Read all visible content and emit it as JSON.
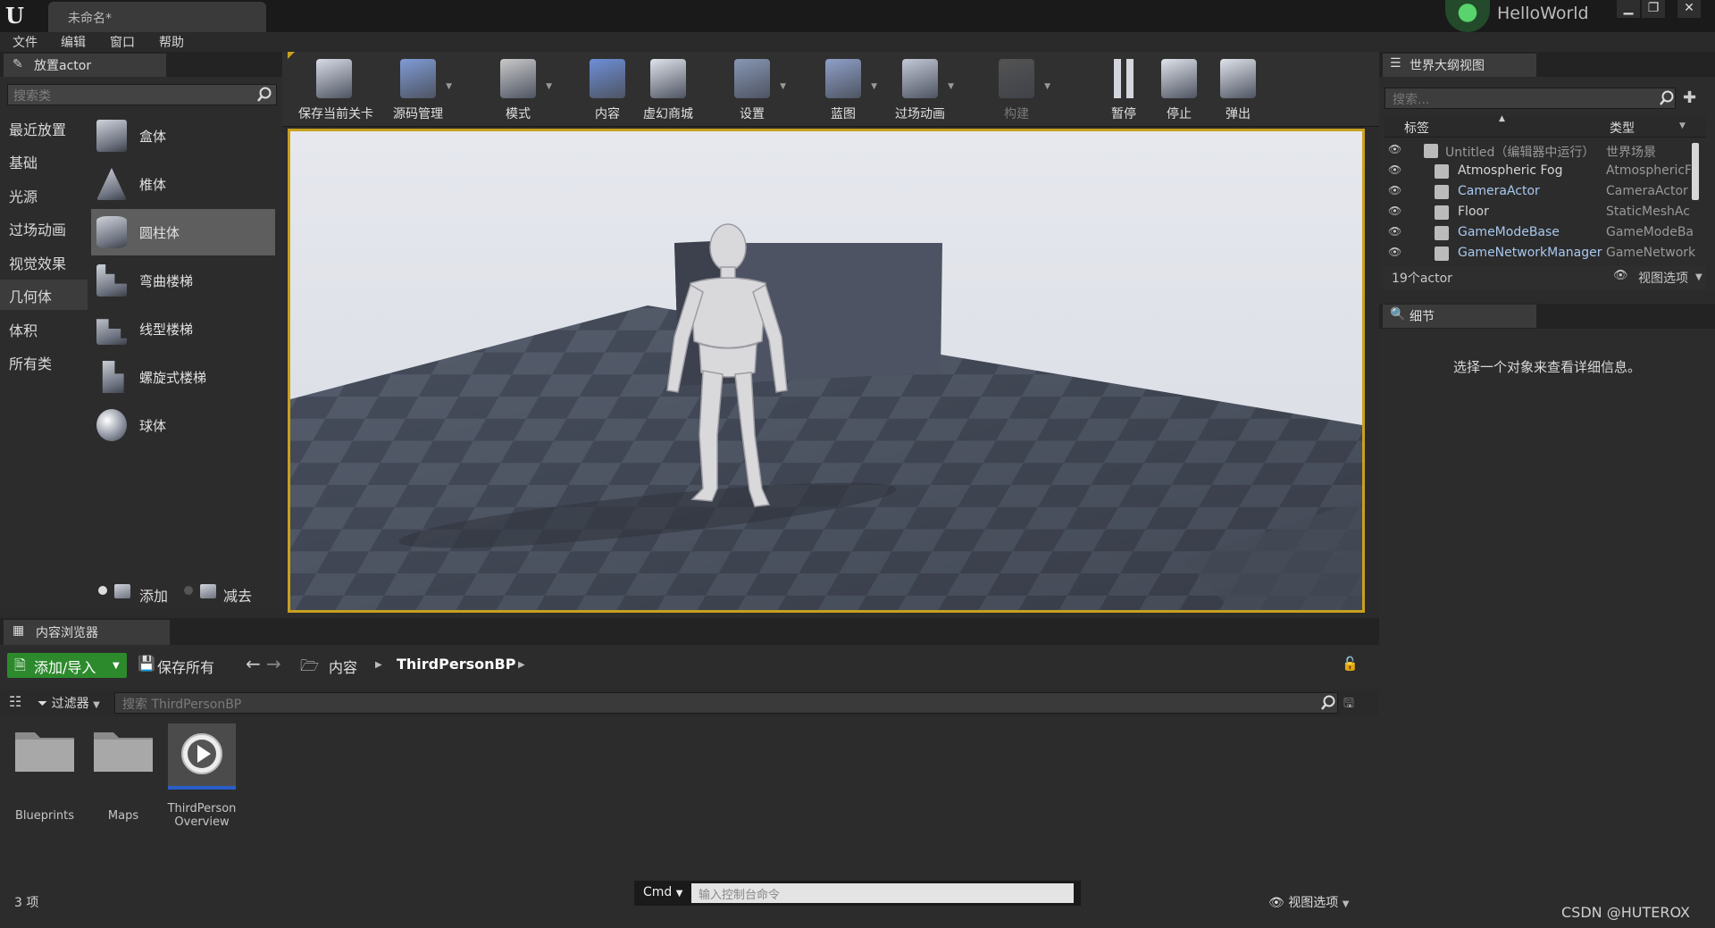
{
  "title_bar": {
    "tab_label": "未命名*",
    "project_name": "HelloWorld",
    "logo_text": "U"
  },
  "menu": [
    "文件",
    "编辑",
    "窗口",
    "帮助"
  ],
  "place_actor": {
    "tab_label": "放置actor",
    "search_placeholder": "搜索类",
    "categories": [
      "最近放置",
      "基础",
      "光源",
      "过场动画",
      "视觉效果",
      "几何体",
      "体积",
      "所有类"
    ],
    "active_category": "几何体",
    "items": [
      "盒体",
      "椎体",
      "圆柱体",
      "弯曲楼梯",
      "线型楼梯",
      "螺旋式楼梯",
      "球体"
    ],
    "selected_item": "圆柱体",
    "mode_add": "添加",
    "mode_subtract": "减去"
  },
  "toolbar": {
    "items": [
      {
        "label": "保存当前关卡",
        "icon": "save-icon",
        "dropdown": false
      },
      {
        "label": "源码管理",
        "icon": "source-control-icon",
        "dropdown": true
      },
      {
        "label": "模式",
        "icon": "modes-icon",
        "dropdown": true
      },
      {
        "label": "内容",
        "icon": "content-icon",
        "dropdown": false
      },
      {
        "label": "虚幻商城",
        "icon": "marketplace-icon",
        "dropdown": false
      },
      {
        "label": "设置",
        "icon": "settings-icon",
        "dropdown": true
      },
      {
        "label": "蓝图",
        "icon": "blueprint-icon",
        "dropdown": true
      },
      {
        "label": "过场动画",
        "icon": "cinematics-icon",
        "dropdown": true
      },
      {
        "label": "构建",
        "icon": "build-icon",
        "dropdown": true
      },
      {
        "label": "暂停",
        "icon": "pause-icon",
        "dropdown": false
      },
      {
        "label": "停止",
        "icon": "stop-icon",
        "dropdown": false
      },
      {
        "label": "弹出",
        "icon": "eject-icon",
        "dropdown": false
      }
    ]
  },
  "world_outliner": {
    "tab_label": "世界大纲视图",
    "search_placeholder": "搜索...",
    "col_label": "标签",
    "col_type": "类型",
    "rows": [
      {
        "name": "Untitled（编辑器中运行）",
        "type": "世界场景"
      },
      {
        "name": "Atmospheric Fog",
        "type": "AtmosphericF"
      },
      {
        "name": "CameraActor",
        "type": "CameraActor"
      },
      {
        "name": "Floor",
        "type": "StaticMeshAc"
      },
      {
        "name": "GameModeBase",
        "type": "GameModeBa"
      },
      {
        "name": "GameNetworkManager",
        "type": "GameNetwork"
      }
    ],
    "actor_count": "19个actor",
    "view_options": "视图选项"
  },
  "details": {
    "tab_label": "细节",
    "empty_text": "选择一个对象来查看详细信息。"
  },
  "content_browser": {
    "tab_label": "内容浏览器",
    "add_import": "添加/导入",
    "save_all": "保存所有",
    "breadcrumb_root": "内容",
    "breadcrumb_folder": "ThirdPersonBP",
    "filters": "过滤器",
    "search_placeholder": "搜索 ThirdPersonBP",
    "assets": [
      {
        "name": "Blueprints",
        "kind": "folder"
      },
      {
        "name": "Maps",
        "kind": "folder"
      },
      {
        "name": "ThirdPerson\nOverview",
        "kind": "level-sequence"
      }
    ],
    "item_count": "3 项",
    "view_options": "视图选项"
  },
  "console": {
    "cmd_label": "Cmd",
    "placeholder": "输入控制台命令"
  },
  "watermark": "CSDN @HUTEROX",
  "colors": {
    "accent_green": "#2c8a2c",
    "viewport_border": "#c8a020",
    "link_blue": "#a8c8ef"
  }
}
